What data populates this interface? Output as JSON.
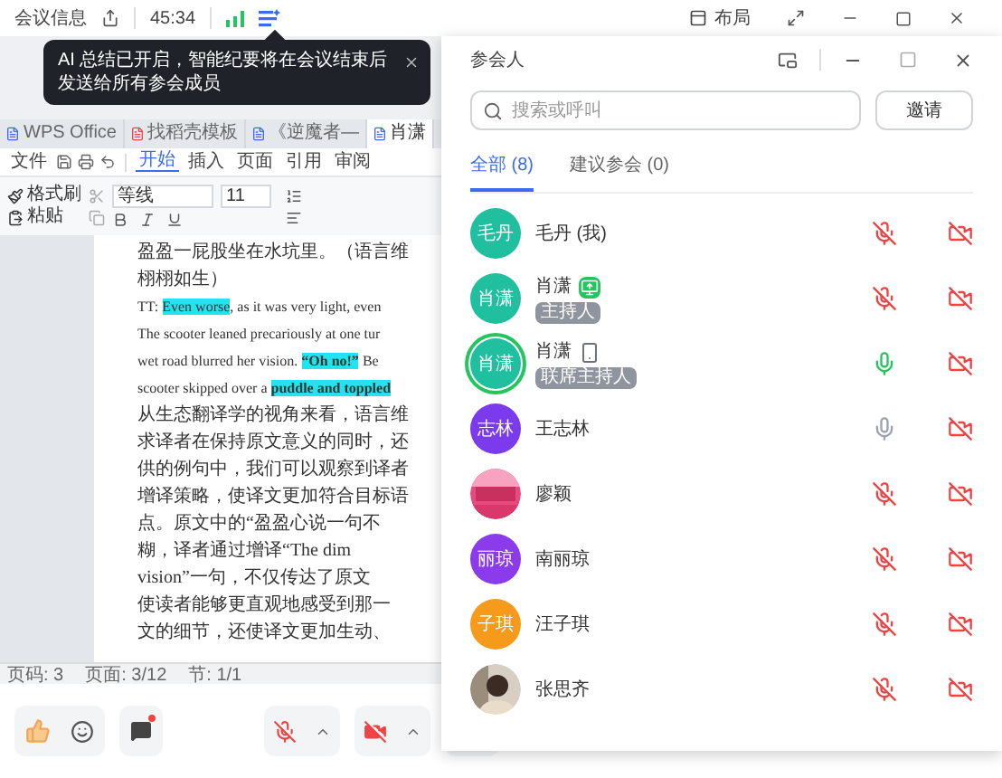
{
  "top_bar": {
    "meeting_info": "会议信息",
    "timer": "45:34",
    "layout_button": "布局"
  },
  "tooltip": {
    "text": "AI 总结已开启，智能纪要将在会议结束后发送给所有参会成员"
  },
  "shared_document": {
    "tabs": [
      {
        "label": "WPS Office",
        "selected": false
      },
      {
        "label": "找稻壳模板",
        "selected": false
      },
      {
        "label": "《逆魔者—",
        "selected": false
      },
      {
        "label": "肖潇",
        "selected": true
      }
    ],
    "menu": [
      {
        "label": "文件",
        "selected": false
      },
      {
        "label": "开始",
        "selected": true
      },
      {
        "label": "插入",
        "selected": false
      },
      {
        "label": "页面",
        "selected": false
      },
      {
        "label": "引用",
        "selected": false
      },
      {
        "label": "审阅",
        "selected": false
      }
    ],
    "ribbon": {
      "format_painter": "格式刷",
      "paste": "粘贴",
      "font": "等线",
      "font_size": "11"
    },
    "lines": [
      [
        {
          "text": "盈盈一屁股坐在水坑里。（语言维",
          "highlighted": false,
          "bold": false
        }
      ],
      [
        {
          "text": "栩栩如生）",
          "highlighted": false,
          "bold": false
        }
      ],
      [
        {
          "text": "TT: ",
          "highlighted": false,
          "bold": false
        },
        {
          "text": "Even worse",
          "highlighted": true,
          "bold": false
        },
        {
          "text": ", as it was very light, even",
          "highlighted": false,
          "bold": false
        }
      ],
      [
        {
          "text": "The scooter leaned precariously at one tur",
          "highlighted": false,
          "bold": false
        }
      ],
      [
        {
          "text": "wet road blurred her vision. ",
          "highlighted": false,
          "bold": false
        },
        {
          "text": "“Oh no!”",
          "highlighted": true,
          "bold": true
        },
        {
          "text": " Be",
          "highlighted": false,
          "bold": false
        }
      ],
      [
        {
          "text": "scooter skipped over a ",
          "highlighted": false,
          "bold": false
        },
        {
          "text": "puddle and toppled",
          "highlighted": true,
          "bold": true
        }
      ],
      [
        {
          "text": "从生态翻译学的视角来看，语言维",
          "highlighted": false,
          "bold": false
        }
      ],
      [
        {
          "text": "求译者在保持原文意义的同时，还",
          "highlighted": false,
          "bold": false
        }
      ],
      [
        {
          "text": "供的例句中，我们可以观察到译者",
          "highlighted": false,
          "bold": false
        }
      ],
      [
        {
          "text": "增译策略，使译文更加符合目标语",
          "highlighted": false,
          "bold": false
        }
      ],
      [
        {
          "text": "点。原文中的“盈盈心说一句不",
          "highlighted": false,
          "bold": false
        }
      ],
      [
        {
          "text": "糊，译者通过增译“The dim",
          "highlighted": false,
          "bold": false
        }
      ],
      [
        {
          "text": "vision”一句，不仅传达了原文",
          "highlighted": false,
          "bold": false
        }
      ],
      [
        {
          "text": "使读者能够更直观地感受到那一",
          "highlighted": false,
          "bold": false
        }
      ],
      [
        {
          "text": "文的细节，还使译文更加生动、",
          "highlighted": false,
          "bold": false
        }
      ]
    ],
    "status_bar": [
      "页码: 3",
      "页面: 3/12",
      "节: 1/1"
    ]
  },
  "participants_panel": {
    "title": "参会人",
    "search": {
      "placeholder": "搜索或呼叫"
    },
    "invite_button": "邀请",
    "tabs": [
      {
        "label": "全部 (8)",
        "selected": true
      },
      {
        "label": "建议参会 (0)",
        "selected": false
      }
    ],
    "participants": [
      {
        "name": "毛丹 (我)",
        "avatar": {
          "kind": "initials",
          "text": "毛丹",
          "color": "#1fbf9f"
        },
        "sharing_screen": false,
        "on_phone": false,
        "muted": true,
        "speaking": false,
        "camera_on": false
      },
      {
        "name": "肖潇",
        "avatar": {
          "kind": "initials",
          "text": "肖潇",
          "color": "#1fbf9f"
        },
        "sharing_screen": true,
        "on_phone": false,
        "badge": "主持人",
        "muted": true,
        "speaking": false,
        "camera_on": false
      },
      {
        "name": "肖潇",
        "avatar": {
          "kind": "initials",
          "text": "肖潇",
          "color": "#1fbf9f"
        },
        "sharing_screen": false,
        "on_phone": true,
        "badge": "联席主持人",
        "muted": false,
        "speaking": true,
        "camera_on": false
      },
      {
        "name": "王志林",
        "avatar": {
          "kind": "initials",
          "text": "志林",
          "color": "#7c3aed"
        },
        "sharing_screen": false,
        "on_phone": false,
        "muted": false,
        "speaking": false,
        "camera_on": false
      },
      {
        "name": "廖颖",
        "sharing_screen": false,
        "on_phone": false,
        "muted": true,
        "speaking": false,
        "camera_on": false
      },
      {
        "name": "南丽琼",
        "avatar": {
          "kind": "initials",
          "text": "丽琼",
          "color": "#8b3bea"
        },
        "sharing_screen": false,
        "on_phone": false,
        "muted": true,
        "speaking": false,
        "camera_on": false
      },
      {
        "name": "汪子琪",
        "avatar": {
          "kind": "initials",
          "text": "子琪",
          "color": "#f59a1b"
        },
        "sharing_screen": false,
        "on_phone": false,
        "muted": true,
        "speaking": false,
        "camera_on": false
      },
      {
        "name": "张思齐",
        "sharing_screen": false,
        "on_phone": false,
        "muted": true,
        "speaking": false,
        "camera_on": false
      }
    ]
  }
}
